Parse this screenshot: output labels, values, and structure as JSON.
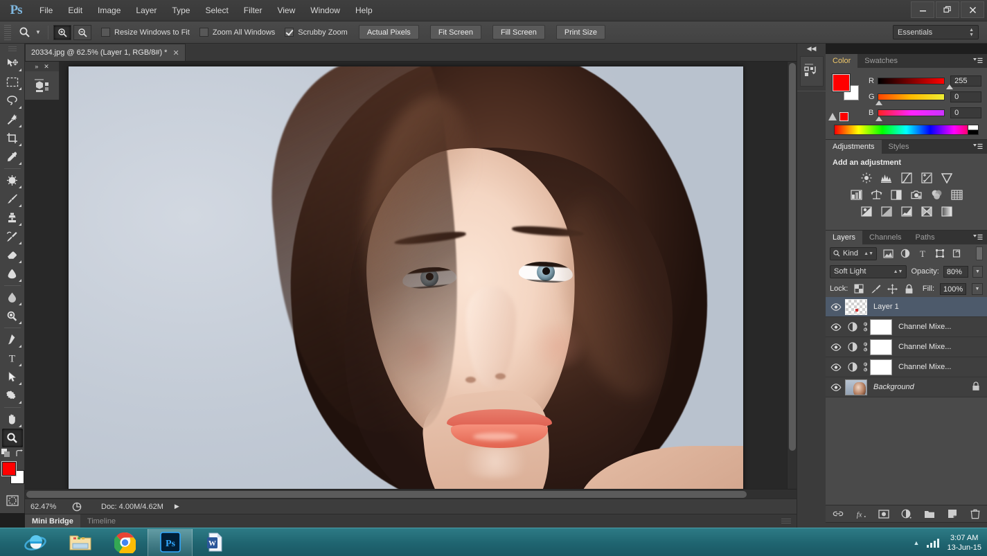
{
  "app": {
    "logo": "Ps",
    "title": "Adobe Photoshop"
  },
  "menu": {
    "items": [
      "File",
      "Edit",
      "Image",
      "Layer",
      "Type",
      "Select",
      "Filter",
      "View",
      "Window",
      "Help"
    ]
  },
  "window_controls": {
    "minimize": "—",
    "restore": "❐",
    "close": "✕"
  },
  "options_bar": {
    "tool_icon": "zoom-tool-icon",
    "zoom_in_label": "+",
    "zoom_out_label": "−",
    "checkboxes": [
      {
        "label": "Resize Windows to Fit",
        "checked": false
      },
      {
        "label": "Zoom All Windows",
        "checked": false
      },
      {
        "label": "Scrubby Zoom",
        "checked": true
      }
    ],
    "buttons": [
      "Actual Pixels",
      "Fit Screen",
      "Fill Screen",
      "Print Size"
    ],
    "workspace": "Essentials"
  },
  "tools": {
    "group1": [
      "move-tool",
      "marquee-tool",
      "lasso-tool",
      "magic-wand-tool",
      "crop-tool",
      "eyedropper-tool"
    ],
    "group2": [
      "spot-healing-tool",
      "brush-tool",
      "clone-stamp-tool",
      "history-brush-tool",
      "eraser-tool",
      "gradient-tool"
    ],
    "group3": [
      "blur-tool",
      "dodge-tool"
    ],
    "group4": [
      "pen-tool",
      "type-tool",
      "path-selection-tool",
      "shape-tool"
    ],
    "group5": [
      "hand-tool",
      "zoom-tool"
    ],
    "active": "zoom-tool",
    "foreground_color": "#ff0000",
    "background_color": "#ffffff",
    "quick_mask": "quick-mask-icon"
  },
  "document": {
    "tab_title": "20334.jpg @ 62.5% (Layer 1, RGB/8#) *",
    "close_label": "✕",
    "mini_bridge_collapsed": {
      "expand": "»",
      "close": "✕"
    }
  },
  "status_bar": {
    "zoom": "62.47%",
    "doc_info": "Doc: 4.00M/4.62M",
    "arrow": "▶"
  },
  "bottom_tabs": {
    "items": [
      {
        "label": "Mini Bridge",
        "active": true
      },
      {
        "label": "Timeline",
        "active": false
      }
    ]
  },
  "right_strip": {
    "collapse": "◀◀",
    "icon": "history-actions-icon"
  },
  "color_panel": {
    "tabs": [
      {
        "label": "Color",
        "active": true
      },
      {
        "label": "Swatches",
        "active": false
      }
    ],
    "menu": "▼▤",
    "foreground": "#ff0000",
    "background": "#ffffff",
    "channels": [
      {
        "label": "R",
        "value": "255",
        "pos": 100
      },
      {
        "label": "G",
        "value": "0",
        "pos": 0
      },
      {
        "label": "B",
        "value": "0",
        "pos": 0
      }
    ],
    "out_of_gamut_icon": "gamut-warning-icon",
    "out_of_gamut_color": "#ff0000"
  },
  "adjustments_panel": {
    "tabs": [
      {
        "label": "Adjustments",
        "active": true
      },
      {
        "label": "Styles",
        "active": false
      }
    ],
    "heading": "Add an adjustment",
    "rows": [
      [
        "brightness-contrast-icon",
        "levels-icon",
        "curves-icon",
        "exposure-icon",
        "vibrance-icon"
      ],
      [
        "hue-saturation-icon",
        "color-balance-icon",
        "black-white-icon",
        "photo-filter-icon",
        "channel-mixer-icon",
        "color-lookup-icon"
      ],
      [
        "invert-icon",
        "posterize-icon",
        "threshold-icon",
        "selective-color-icon",
        "gradient-map-icon"
      ]
    ]
  },
  "layers_panel": {
    "tabs": [
      {
        "label": "Layers",
        "active": true
      },
      {
        "label": "Channels",
        "active": false
      },
      {
        "label": "Paths",
        "active": false
      }
    ],
    "menu": "▼▤",
    "filter": {
      "kind_label": "Kind",
      "search_icon": "search-icon",
      "icons": [
        "pixel-filter-icon",
        "adjustment-filter-icon",
        "type-filter-icon",
        "shape-filter-icon",
        "smart-object-filter-icon"
      ]
    },
    "blend_mode": "Soft Light",
    "opacity_label": "Opacity:",
    "opacity_value": "80%",
    "lock_label": "Lock:",
    "lock_icons": [
      "lock-transparency-icon",
      "lock-image-icon",
      "lock-position-icon",
      "lock-all-icon"
    ],
    "fill_label": "Fill:",
    "fill_value": "100%",
    "layers": [
      {
        "name": "Layer 1",
        "type": "pixel",
        "selected": true,
        "visible": true,
        "locked": false,
        "italic": false
      },
      {
        "name": "Channel Mixe...",
        "type": "adjustment",
        "selected": false,
        "visible": true,
        "locked": false,
        "italic": false
      },
      {
        "name": "Channel Mixe...",
        "type": "adjustment",
        "selected": false,
        "visible": true,
        "locked": false,
        "italic": false
      },
      {
        "name": "Channel Mixe...",
        "type": "adjustment",
        "selected": false,
        "visible": true,
        "locked": false,
        "italic": false
      },
      {
        "name": "Background",
        "type": "photo",
        "selected": false,
        "visible": true,
        "locked": true,
        "italic": true
      }
    ],
    "footer_icons": [
      "link-layers-icon",
      "layer-style-fx-icon",
      "add-mask-icon",
      "new-adjustment-icon",
      "new-group-icon",
      "new-layer-icon",
      "delete-layer-icon"
    ]
  },
  "taskbar": {
    "items": [
      {
        "name": "internet-explorer",
        "active": false
      },
      {
        "name": "file-explorer",
        "active": false
      },
      {
        "name": "google-chrome",
        "active": false
      },
      {
        "name": "photoshop",
        "active": true
      },
      {
        "name": "microsoft-word",
        "active": false
      }
    ],
    "tray": {
      "show_hidden": "▲",
      "network_icon": "signal-bars-icon"
    },
    "clock": {
      "time": "3:07 AM",
      "date": "13-Jun-15"
    }
  }
}
